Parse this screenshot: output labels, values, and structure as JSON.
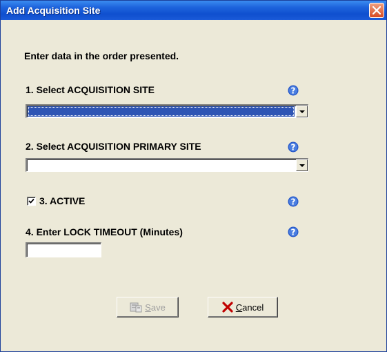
{
  "window": {
    "title": "Add Acquisition Site"
  },
  "form": {
    "intro": "Enter data in the order presented.",
    "step1": {
      "label": "1. Select ACQUISITION SITE",
      "selected_value": ""
    },
    "step2": {
      "label": "2. Select ACQUISITION PRIMARY SITE",
      "selected_value": ""
    },
    "step3": {
      "label": "3. ACTIVE",
      "checked": true
    },
    "step4": {
      "label": "4. Enter LOCK TIMEOUT (Minutes)",
      "value": ""
    }
  },
  "buttons": {
    "save": {
      "mnemonic": "S",
      "rest": "ave",
      "enabled": false
    },
    "cancel": {
      "mnemonic": "C",
      "rest": "ancel",
      "enabled": true
    }
  },
  "icons": {
    "help": "help-question-icon",
    "close": "close-icon",
    "save": "save-icon",
    "cancel": "cancel-x-icon"
  },
  "colors": {
    "title_bar": "#1d63dc",
    "dialog_bg": "#ece9d8",
    "selection": "#2e55b4",
    "close_button": "#d84a22",
    "cancel_x": "#c00000"
  }
}
